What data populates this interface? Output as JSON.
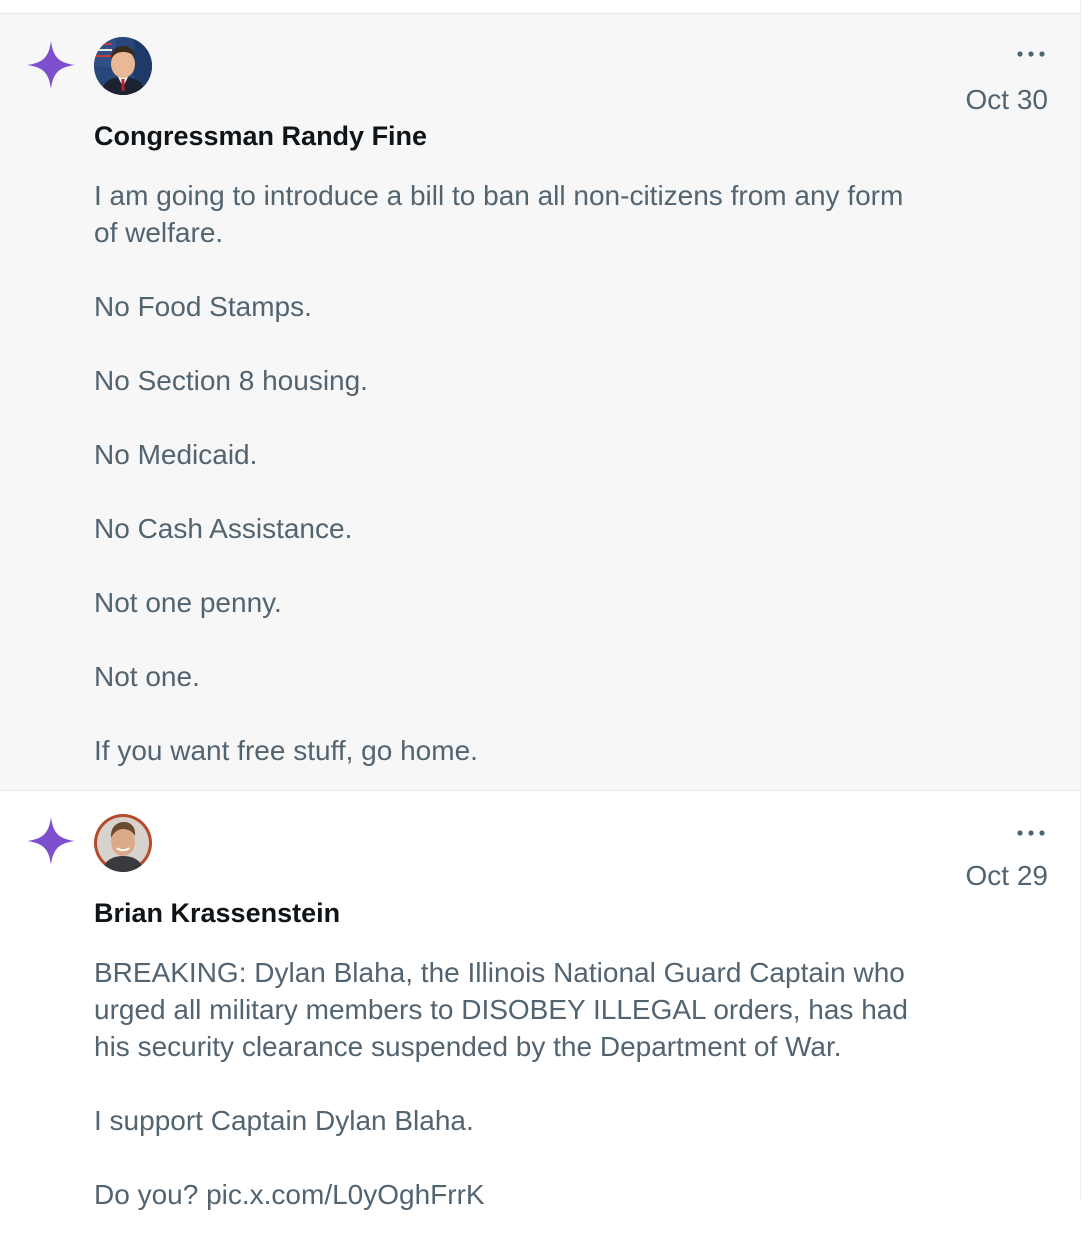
{
  "colors": {
    "sparkle": "#7d4fce",
    "author_text": "#0f1419",
    "body_text": "#536471",
    "highlight_bg": "#f7f7f7",
    "avatar_1_bg": "#27467a",
    "avatar_2_bg": "#b44b2c"
  },
  "icons": {
    "sparkle": "sparkle-icon",
    "more": "more-horizontal-icon"
  },
  "feed": {
    "posts": [
      {
        "author": "Congressman Randy Fine",
        "date": "Oct 30",
        "paragraphs": [
          "I am going to introduce a bill to ban all non-citizens from any form of welfare.",
          "No Food Stamps.",
          "No Section 8 housing.",
          "No Medicaid.",
          "No Cash Assistance.",
          "Not one penny.",
          "Not one.",
          "If you want free stuff, go home."
        ]
      },
      {
        "author": "Brian Krassenstein",
        "date": "Oct 29",
        "paragraphs": [
          "BREAKING: Dylan Blaha, the Illinois National Guard Captain who urged all military members to DISOBEY ILLEGAL orders, has had his security clearance suspended by the Department of War.",
          "I support Captain Dylan Blaha.",
          "Do you? pic.x.com/L0yOghFrrK"
        ]
      }
    ]
  }
}
